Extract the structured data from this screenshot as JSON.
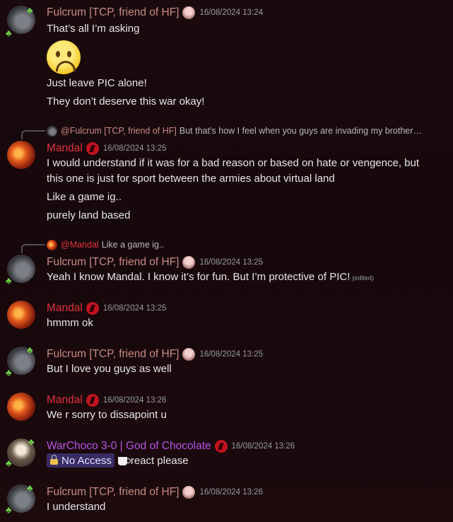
{
  "users": {
    "fulcrum": "Fulcrum [TCP,  friend of HF]",
    "mandal": "Mandal",
    "warchoco": "WarChoco 3-0 | God of Chocolate"
  },
  "messages": [
    {
      "author": "fulcrum",
      "time": "16/08/2024 13:24",
      "lines": [
        "That’s all I’m asking",
        "Just leave PIC alone!",
        "They don’t deserve this war okay!"
      ],
      "emoji": "frowning-face-emoji"
    },
    {
      "author": "mandal",
      "time": "16/08/2024 13:25",
      "reply": {
        "name": "@Fulcrum [TCP,  friend of HF]",
        "text": "But that’s how I feel when you guys are invading my brother…"
      },
      "lines": [
        "I would understand if it was for a bad reason or based on hate or vengence, but",
        "this one is just for sport between the armies about virtual land",
        "Like a game ig..",
        "purely land based"
      ]
    },
    {
      "author": "fulcrum",
      "time": "16/08/2024 13:25",
      "reply": {
        "name": "@Mandal",
        "text": "Like a game ig.."
      },
      "lines": [
        "Yeah I know Mandal. I know it’s for fun. But I’m protective of PIC!"
      ],
      "edited": "(edited)"
    },
    {
      "author": "mandal",
      "time": "16/08/2024 13:25",
      "lines": [
        "hmmm ok"
      ]
    },
    {
      "author": "fulcrum",
      "time": "16/08/2024 13:25",
      "lines": [
        "But I love you guys as well"
      ]
    },
    {
      "author": "mandal",
      "time": "16/08/2024 13:26",
      "lines": [
        "We r sorry to dissapoint u"
      ]
    },
    {
      "author": "warchoco",
      "time": "16/08/2024 13:26",
      "pill": "No Access",
      "lines": [
        "react please"
      ]
    },
    {
      "author": "fulcrum",
      "time": "16/08/2024 13:26",
      "lines": [
        "I understand"
      ]
    }
  ],
  "colors": {
    "fulcrum": "#c98a83",
    "mandal": "#e0313d",
    "warchoco": "#b854e8",
    "timestamp": "#949ba4",
    "text": "#e6e7e9"
  }
}
